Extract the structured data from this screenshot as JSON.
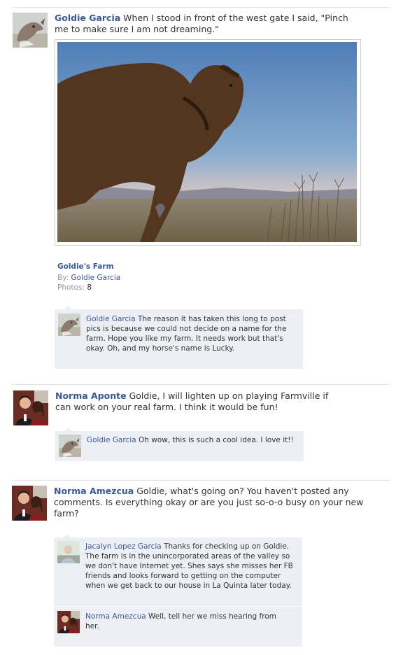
{
  "post1": {
    "author": "Goldie Garcia",
    "text_line1": "When I stood in front of the west gate I said, \"Pinch",
    "text_line2": "me to make sure I am not dreaming.\"",
    "album": {
      "title": "Goldie's Farm",
      "by_label": "By:",
      "by_value": "Goldie Garcia",
      "photos_label": "Photos:",
      "photos_value": "8"
    },
    "comments": [
      {
        "author": "Goldie Garcia",
        "lines": [
          "The reason it has taken this long to post",
          "pics is because we could not decide on a name for the",
          "farm. Hope you like my farm. It needs work but that's",
          "okay. Oh, and my horse's name is Lucky."
        ]
      }
    ]
  },
  "post2": {
    "author": "Norma Aponte",
    "text_line1": "Goldie, I will lighten up on playing Farmville if",
    "text_line2": "can work on your real farm. I think it would be fun!",
    "comments": [
      {
        "author": "Goldie Garcia",
        "lines": [
          "Oh wow, this is such a cool idea. I love it!!"
        ]
      }
    ]
  },
  "post3": {
    "author": "Norma Amezcua",
    "text_line1": "Goldie, what's going on? You haven't posted any",
    "text_line2": "comments. Is everything okay or are you just so-o-o busy on your new",
    "text_line3": "farm?",
    "comments": [
      {
        "author": "Jacalyn Lopez Garcia",
        "lines": [
          "Thanks for checking up on Goldie.",
          "The farm is in the unincorporated areas of the valley so",
          "we don't have Internet yet. Shes says she misses her FB",
          "friends and looks forward to getting on the computer",
          "when we get back to our house in La Quinta later today."
        ]
      },
      {
        "author": "Norma Amezcua",
        "lines": [
          "Well, tell her we miss hearing from",
          "her."
        ]
      }
    ]
  },
  "colors": {
    "link": "#3b5998",
    "comment_bg": "#edeff4",
    "separator": "#e2e5ec"
  }
}
